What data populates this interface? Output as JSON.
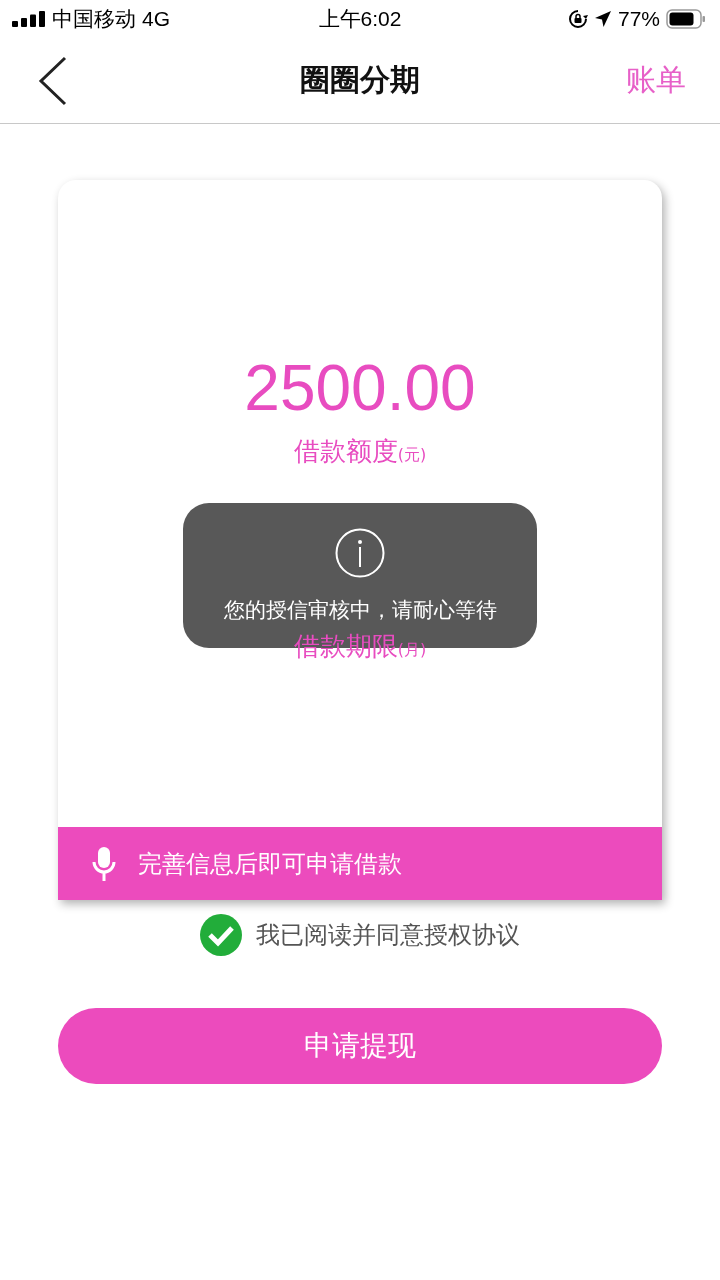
{
  "status_bar": {
    "carrier": "中国移动",
    "network": "4G",
    "time": "上午6:02",
    "battery": "77%"
  },
  "nav": {
    "title": "圈圈分期",
    "action": "账单"
  },
  "card": {
    "amount": "2500.00",
    "amount_label": "借款额度",
    "amount_unit": "(元)",
    "term_label": "借款期限",
    "term_unit": "(月)",
    "banner": "完善信息后即可申请借款"
  },
  "toast": {
    "message": "您的授信审核中，请耐心等待"
  },
  "agreement": {
    "text": "我已阅读并同意授权协议",
    "checked": true
  },
  "submit": {
    "label": "申请提现"
  }
}
